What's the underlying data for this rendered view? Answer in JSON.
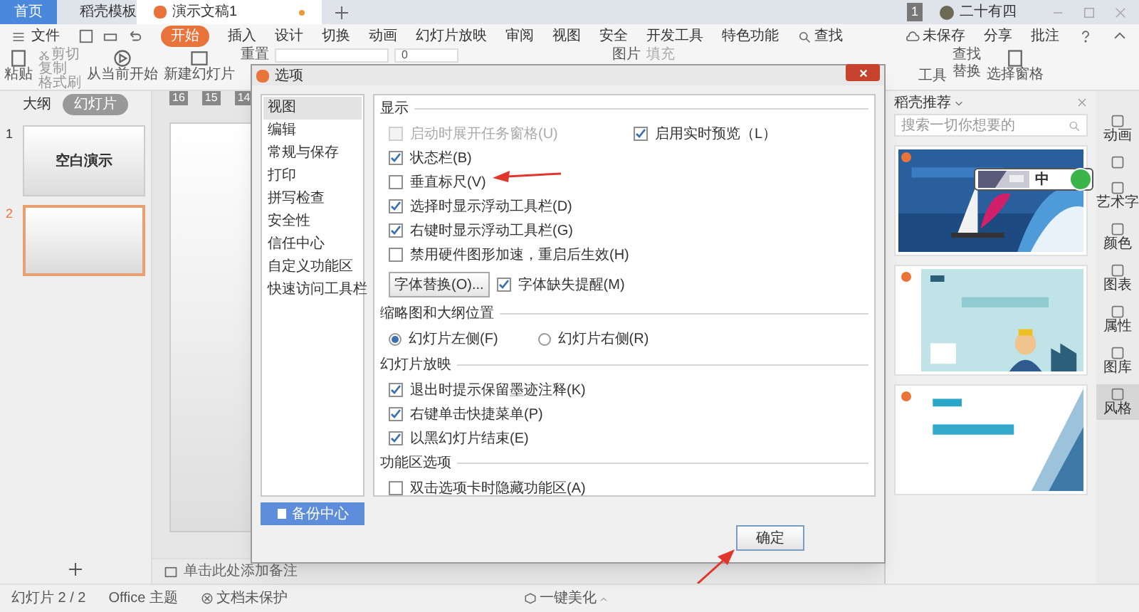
{
  "tabs": [
    {
      "label": "首页",
      "kind": "home",
      "selected": false
    },
    {
      "label": "稻壳模板",
      "kind": "doc",
      "selected": false
    },
    {
      "label": "演示文稿1",
      "kind": "doc",
      "selected": true
    }
  ],
  "account": {
    "badge": "1",
    "name": "二十有四"
  },
  "menu": {
    "file": "文件",
    "items": [
      {
        "label": "开始",
        "selected": true
      },
      {
        "label": "插入",
        "selected": false
      },
      {
        "label": "设计",
        "selected": false
      },
      {
        "label": "切换",
        "selected": false
      },
      {
        "label": "动画",
        "selected": false
      },
      {
        "label": "幻灯片放映",
        "selected": false
      },
      {
        "label": "审阅",
        "selected": false
      },
      {
        "label": "视图",
        "selected": false
      },
      {
        "label": "安全",
        "selected": false
      },
      {
        "label": "开发工具",
        "selected": false
      },
      {
        "label": "特色功能",
        "selected": false
      }
    ],
    "search": "查找",
    "unsaved": "未保存",
    "share": "分享",
    "comment": "批注"
  },
  "ribbon": {
    "paste": "粘贴",
    "cut": "剪切",
    "copy": "复制",
    "format_painter": "格式刷",
    "play_from_current": "从当前开始",
    "new_slide": "新建幻灯片",
    "reset": "重置",
    "font_size": "0",
    "picture": "图片",
    "fill": "填充",
    "tools": "工具",
    "find": "查找",
    "replace": "替换",
    "selection_pane": "选择窗格"
  },
  "left_panel": {
    "tabs": [
      {
        "label": "大纲",
        "selected": false
      },
      {
        "label": "幻灯片",
        "selected": true
      }
    ],
    "slides": [
      {
        "number": "1",
        "title": "空白演示",
        "selected": false
      },
      {
        "number": "2",
        "selected": true
      }
    ]
  },
  "ruler": [
    "16",
    "15",
    "14"
  ],
  "notes_placeholder": "单击此处添加备注",
  "template_pane": {
    "title": "稻壳推荐",
    "search_placeholder": "搜索一切你想要的"
  },
  "side_tools": [
    {
      "label": "动画",
      "selected": false
    },
    {
      "selected": false
    },
    {
      "label": "艺术字",
      "selected": false
    },
    {
      "label": "颜色",
      "selected": false
    },
    {
      "label": "图表",
      "selected": false
    },
    {
      "label": "属性",
      "selected": false
    },
    {
      "label": "图库",
      "selected": false
    },
    {
      "label": "风格",
      "selected": true
    }
  ],
  "ime": {
    "label": "中"
  },
  "dialog": {
    "title": "选项",
    "nav": [
      {
        "label": "视图",
        "selected": true
      },
      {
        "label": "编辑",
        "selected": false
      },
      {
        "label": "常规与保存",
        "selected": false
      },
      {
        "label": "打印",
        "selected": false
      },
      {
        "label": "拼写检查",
        "selected": false
      },
      {
        "label": "安全性",
        "selected": false
      },
      {
        "label": "信任中心",
        "selected": false
      },
      {
        "label": "自定义功能区",
        "selected": false
      },
      {
        "label": "快速访问工具栏",
        "selected": false
      }
    ],
    "backup_button": "备份中心",
    "display": {
      "title": "显示",
      "options": [
        {
          "label": "启动时展开任务窗格(U)",
          "checked": false,
          "disabled": true
        },
        {
          "label": "状态栏(B)",
          "checked": true,
          "disabled": false
        },
        {
          "label": "垂直标尺(V)",
          "checked": false,
          "disabled": false
        },
        {
          "label": "选择时显示浮动工具栏(D)",
          "checked": true,
          "disabled": false
        },
        {
          "label": "右键时显示浮动工具栏(G)",
          "checked": true,
          "disabled": false
        },
        {
          "label": "禁用硬件图形加速，重启后生效(H)",
          "checked": false,
          "disabled": false
        }
      ],
      "live_preview": {
        "label": "启用实时预览（L）",
        "checked": true,
        "disabled": false
      },
      "font_button": "字体替换(O)...",
      "font_warning": {
        "label": "字体缺失提醒(M)",
        "checked": true,
        "disabled": false
      }
    },
    "thumbnail": {
      "title": "缩略图和大纲位置",
      "options": [
        {
          "label": "幻灯片左侧(F)",
          "selected": true
        },
        {
          "label": "幻灯片右侧(R)",
          "selected": false
        }
      ]
    },
    "slideshow": {
      "title": "幻灯片放映",
      "options": [
        {
          "label": "退出时提示保留墨迹注释(K)",
          "checked": true,
          "disabled": false
        },
        {
          "label": "右键单击快捷菜单(P)",
          "checked": true,
          "disabled": false
        },
        {
          "label": "以黑幻灯片结束(E)",
          "checked": true,
          "disabled": false
        }
      ]
    },
    "ribbon_options": {
      "title": "功能区选项",
      "options": [
        {
          "label": "双击选项卡时隐藏功能区(A)",
          "checked": false,
          "disabled": false
        }
      ]
    },
    "ok_button": "确定"
  },
  "status_bar": {
    "slide": "幻灯片 2 / 2",
    "theme": "Office 主题",
    "protection": "文档未保护",
    "beautify": "一键美化"
  }
}
